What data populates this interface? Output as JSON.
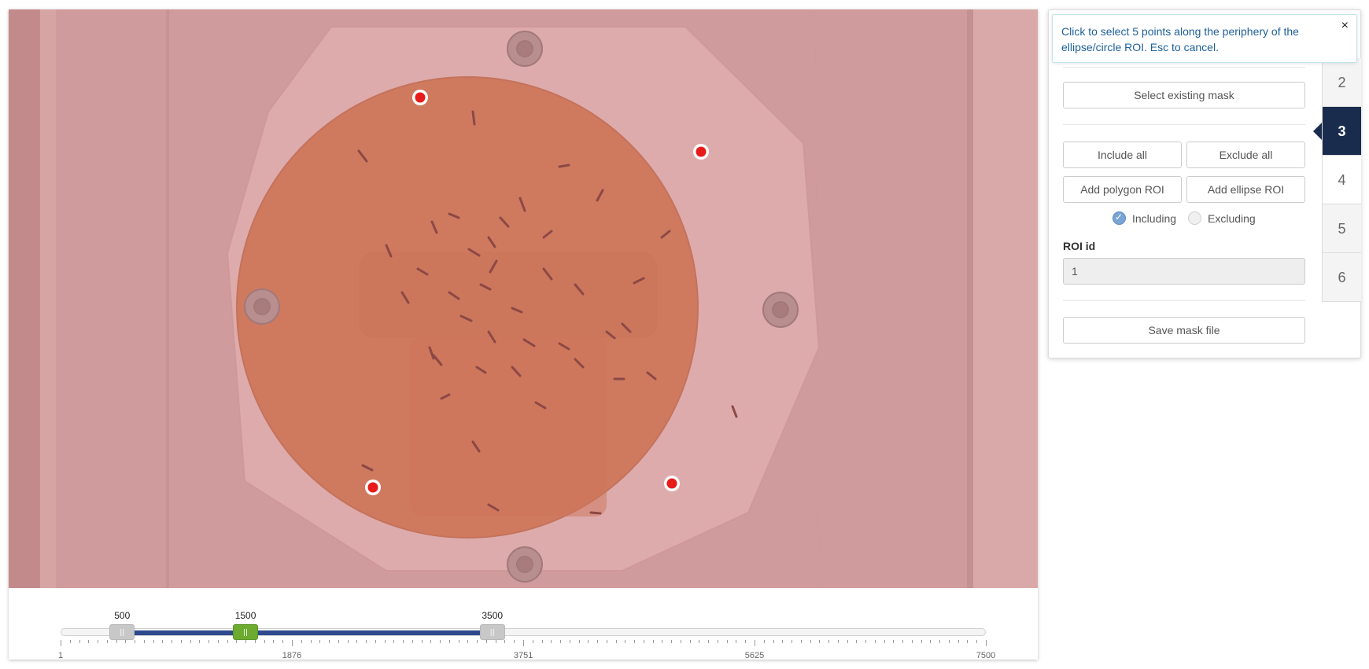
{
  "instruction": {
    "text": "Click to select 5 points along the periphery of the ellipse/circle ROI. Esc to cancel.",
    "close": "×"
  },
  "panel": {
    "select_existing_mask": "Select existing mask",
    "include_all": "Include all",
    "exclude_all": "Exclude all",
    "add_polygon_roi": "Add polygon ROI",
    "add_ellipse_roi": "Add ellipse ROI",
    "including": "Including",
    "excluding": "Excluding",
    "including_selected": true,
    "roi_id_label": "ROI id",
    "roi_id_value": "1",
    "save_mask_file": "Save mask file"
  },
  "steps": [
    {
      "label": "2",
      "active": false
    },
    {
      "label": "3",
      "active": true
    },
    {
      "label": "4",
      "active": false
    },
    {
      "label": "5",
      "active": false
    },
    {
      "label": "6",
      "active": false
    }
  ],
  "slider": {
    "min": 1,
    "max": 7500,
    "handles": [
      {
        "value": 500,
        "label": "500",
        "kind": "range-start"
      },
      {
        "value": 1500,
        "label": "1500",
        "kind": "current"
      },
      {
        "value": 3500,
        "label": "3500",
        "kind": "range-end"
      }
    ],
    "axis_labels": [
      "1",
      "1876",
      "3751",
      "5625",
      "7500"
    ],
    "colors": {
      "range": "#2c4a8c",
      "current": "#6cab2f",
      "bounds": "#c8c8c8"
    }
  },
  "roi_points_selected": 4,
  "colors": {
    "overlay": "#d98c8c",
    "arena": "#c8704a",
    "point": "#e81a1a",
    "active_step": "#1a2c4e",
    "tooltip_text": "#1d5f9a"
  }
}
